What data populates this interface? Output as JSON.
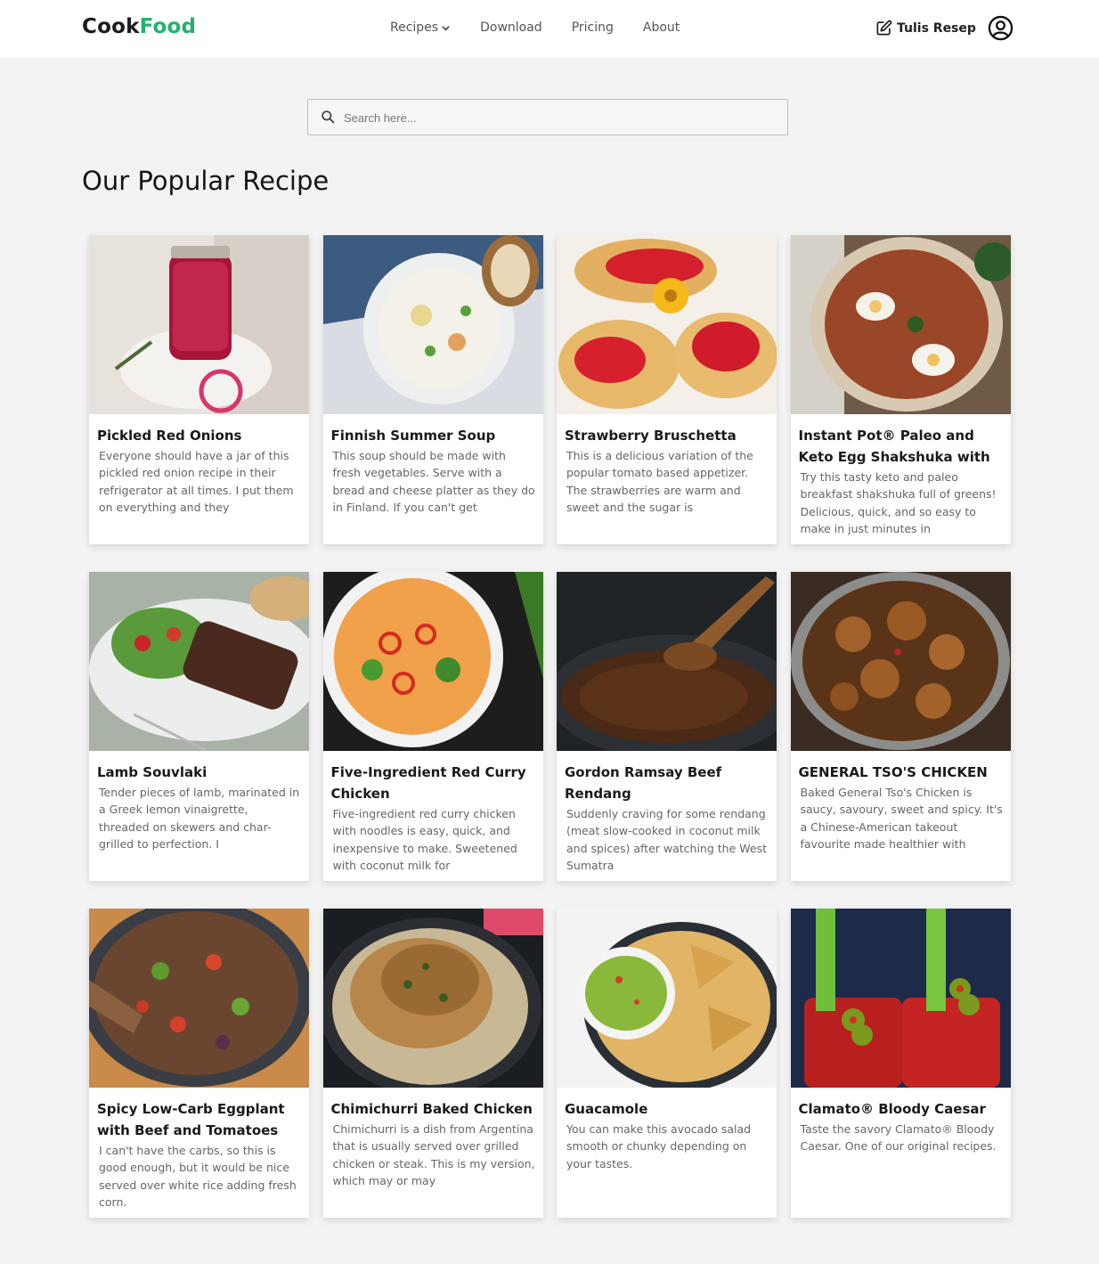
{
  "brand": {
    "part1": "Cook",
    "part2": "Food"
  },
  "nav": {
    "recipes": "Recipes",
    "download": "Download",
    "pricing": "Pricing",
    "about": "About"
  },
  "header": {
    "write_label": "Tulis Resep"
  },
  "search": {
    "placeholder": "Search here..."
  },
  "section_title": "Our Popular Recipe",
  "recipes": [
    {
      "title": "Pickled Red Onions",
      "desc": "Everyone should have a jar of this pickled red onion recipe in their refrigerator at all times. I put them on everything and they"
    },
    {
      "title": "Finnish Summer Soup",
      "desc": "This soup should be made with fresh vegetables. Serve with a bread and cheese platter as they do in Finland. If you can't get"
    },
    {
      "title": "Strawberry Bruschetta",
      "desc": "This is a delicious variation of the popular tomato based appetizer. The strawberries are warm and sweet and the sugar is"
    },
    {
      "title": "Instant Pot® Paleo and Keto Egg Shakshuka with Ka",
      "desc": "Try this tasty keto and paleo breakfast shakshuka full of greens! Delicious, quick, and so easy to make in just minutes in"
    },
    {
      "title": "Lamb Souvlaki",
      "desc": "Tender pieces of lamb, marinated in a Greek lemon vinaigrette, threaded on skewers and char-grilled to perfection. I"
    },
    {
      "title": "Five-Ingredient Red Curry Chicken",
      "desc": "Five-ingredient red curry chicken with noodles is easy, quick, and inexpensive to make. Sweetened with coconut milk for"
    },
    {
      "title": "Gordon Ramsay Beef Rendang",
      "desc": "Suddenly craving for some rendang (meat slow-cooked in coconut milk and spices) after watching the West Sumatra"
    },
    {
      "title": "GENERAL TSO'S CHICKEN",
      "desc": "Baked General Tso's Chicken is saucy, savoury, sweet and spicy. It's a Chinese-American takeout favourite made healthier with"
    },
    {
      "title": "Spicy Low-Carb Eggplant with Beef and Tomatoes",
      "desc": "I can't have the carbs, so this is good enough, but it would be nice served over white rice adding fresh corn."
    },
    {
      "title": "Chimichurri Baked Chicken",
      "desc": "Chimichurri is a dish from Argentina that is usually served over grilled chicken or steak. This is my version, which may or may"
    },
    {
      "title": "Guacamole",
      "desc": "You can make this avocado salad smooth or chunky depending on your tastes."
    },
    {
      "title": "Clamato® Bloody Caesar",
      "desc": "Taste the savory Clamato® Bloody Caesar. One of our original recipes."
    }
  ]
}
